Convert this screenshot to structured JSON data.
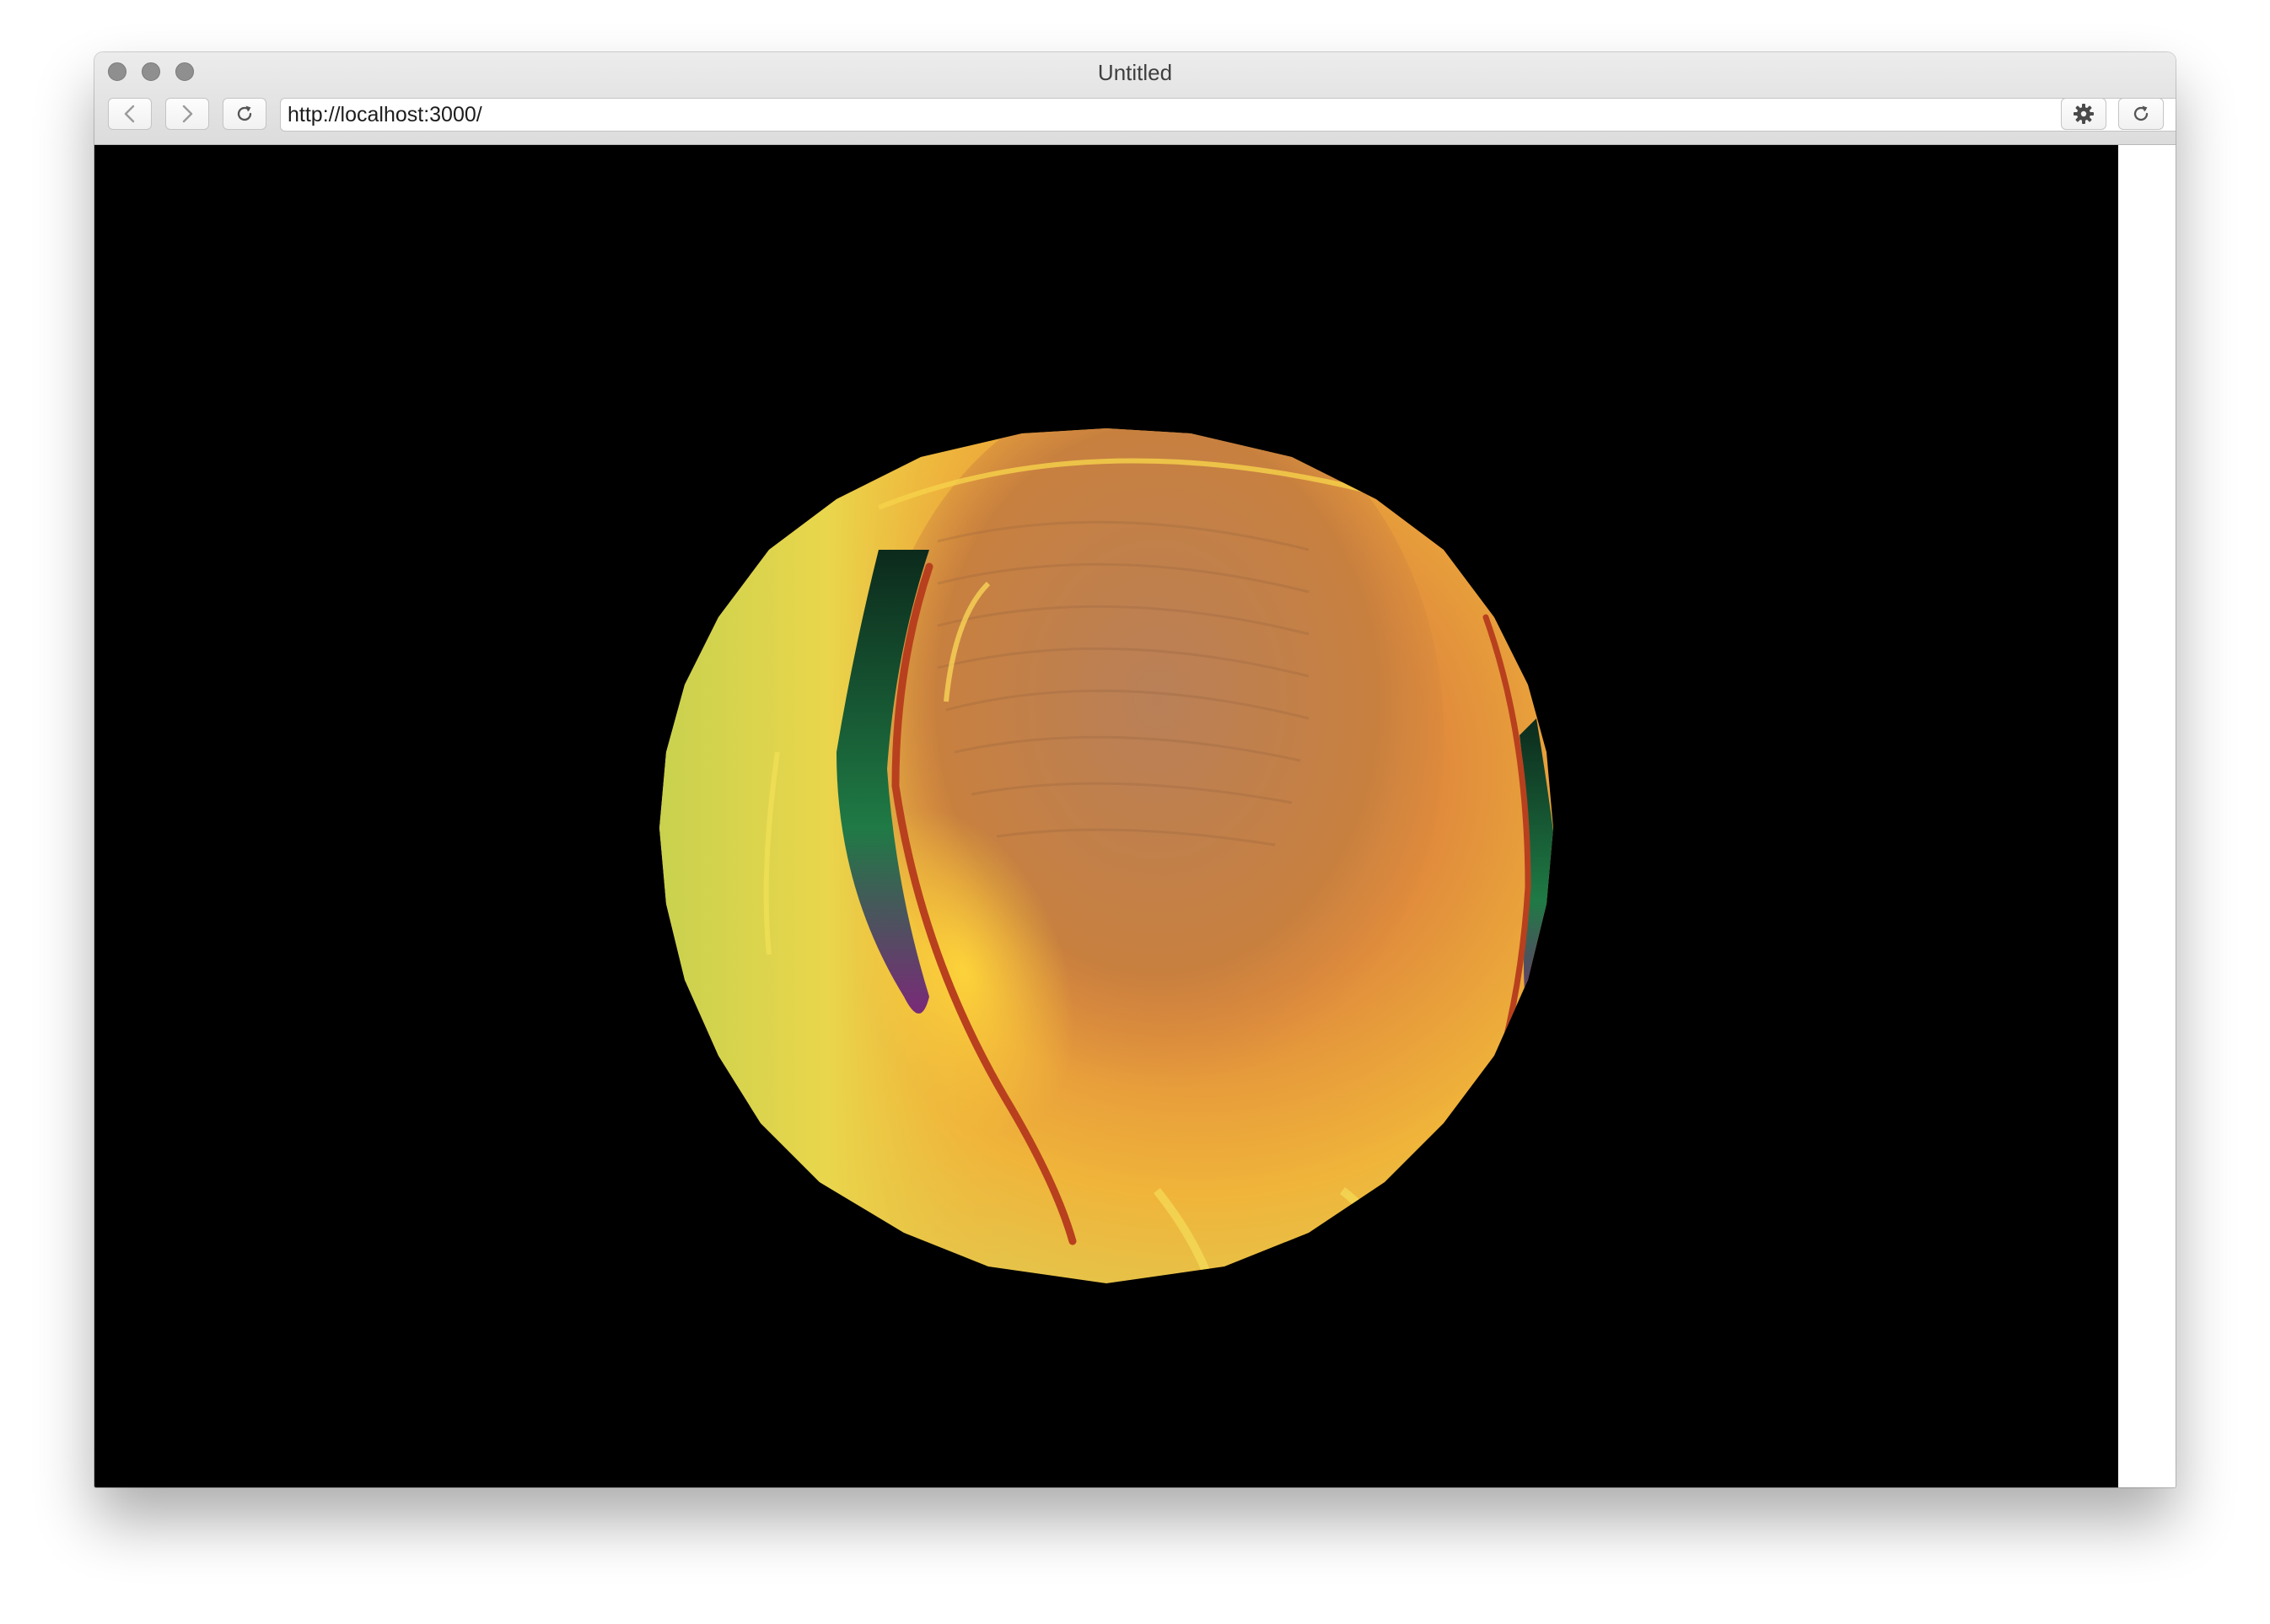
{
  "window": {
    "title": "Untitled"
  },
  "toolbar": {
    "back_icon": "chevron-left-icon",
    "forward_icon": "chevron-right-icon",
    "reload_icon": "reload-icon",
    "settings_icon": "gear-icon",
    "refresh_icon": "refresh-icon"
  },
  "address_bar": {
    "url": "http://localhost:3000/"
  },
  "scene": {
    "background": "#000000",
    "object": "textured-sphere",
    "colors": {
      "orange": "#e08a3c",
      "amber": "#f0b43a",
      "yellow": "#e2dc58",
      "green": "#1f7a45",
      "red_stripe": "#b8401e",
      "purple": "#7a2a78"
    }
  }
}
